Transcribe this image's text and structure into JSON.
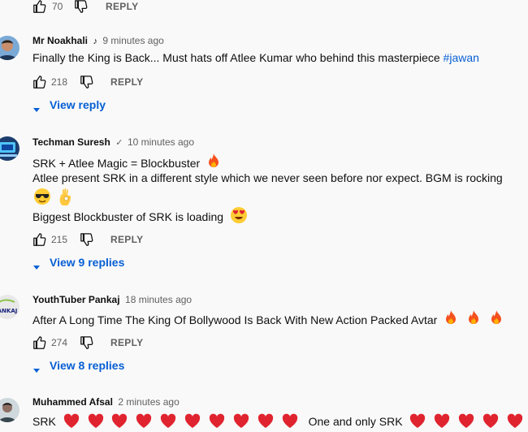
{
  "top_actions": {
    "likes": "70",
    "reply_label": "REPLY"
  },
  "comments": [
    {
      "author": "Mr Noakhali",
      "badge": "music-note-icon",
      "time": "9 minutes ago",
      "line1_text": "Finally the King is Back... Must hats off Atlee Kumar who behind this masterpiece",
      "hashtag": "#jawan",
      "likes": "218",
      "reply_label": "REPLY",
      "view_replies": "View reply"
    },
    {
      "author": "Techman Suresh",
      "badge": "verified-check-icon",
      "time": "10 minutes ago",
      "line1": "SRK + Atlee Magic = Blockbuster",
      "line2": "Atlee present SRK in a different style which we never seen before nor expect. BGM is rocking",
      "line3": "Biggest Blockbuster of SRK is loading",
      "likes": "215",
      "reply_label": "REPLY",
      "view_replies": "View 9 replies"
    },
    {
      "author": "YouthTuber Pankaj",
      "time": "18 minutes ago",
      "line1": "After A Long Time The King Of Bollywood Is Back With New Action Packed Avtar",
      "likes": "274",
      "reply_label": "REPLY",
      "view_replies": "View 8 replies"
    },
    {
      "author": "Muhammed Afsal",
      "time": "2 minutes ago",
      "line1_start": "SRK",
      "line1_mid": "One and only SRK"
    }
  ],
  "icons": {
    "like": "thumbs-up-icon",
    "dislike": "thumbs-down-icon",
    "expand": "caret-down-icon",
    "fire": "fire-emoji",
    "sunglasses": "sunglasses-emoji",
    "ok_hand": "ok-hand-emoji",
    "heart_eyes": "heart-eyes-emoji",
    "heart": "red-heart-emoji"
  },
  "colors": {
    "link": "#065fd4",
    "meta": "#606060",
    "text": "#0f0f0f",
    "heart": "#e0242f"
  }
}
